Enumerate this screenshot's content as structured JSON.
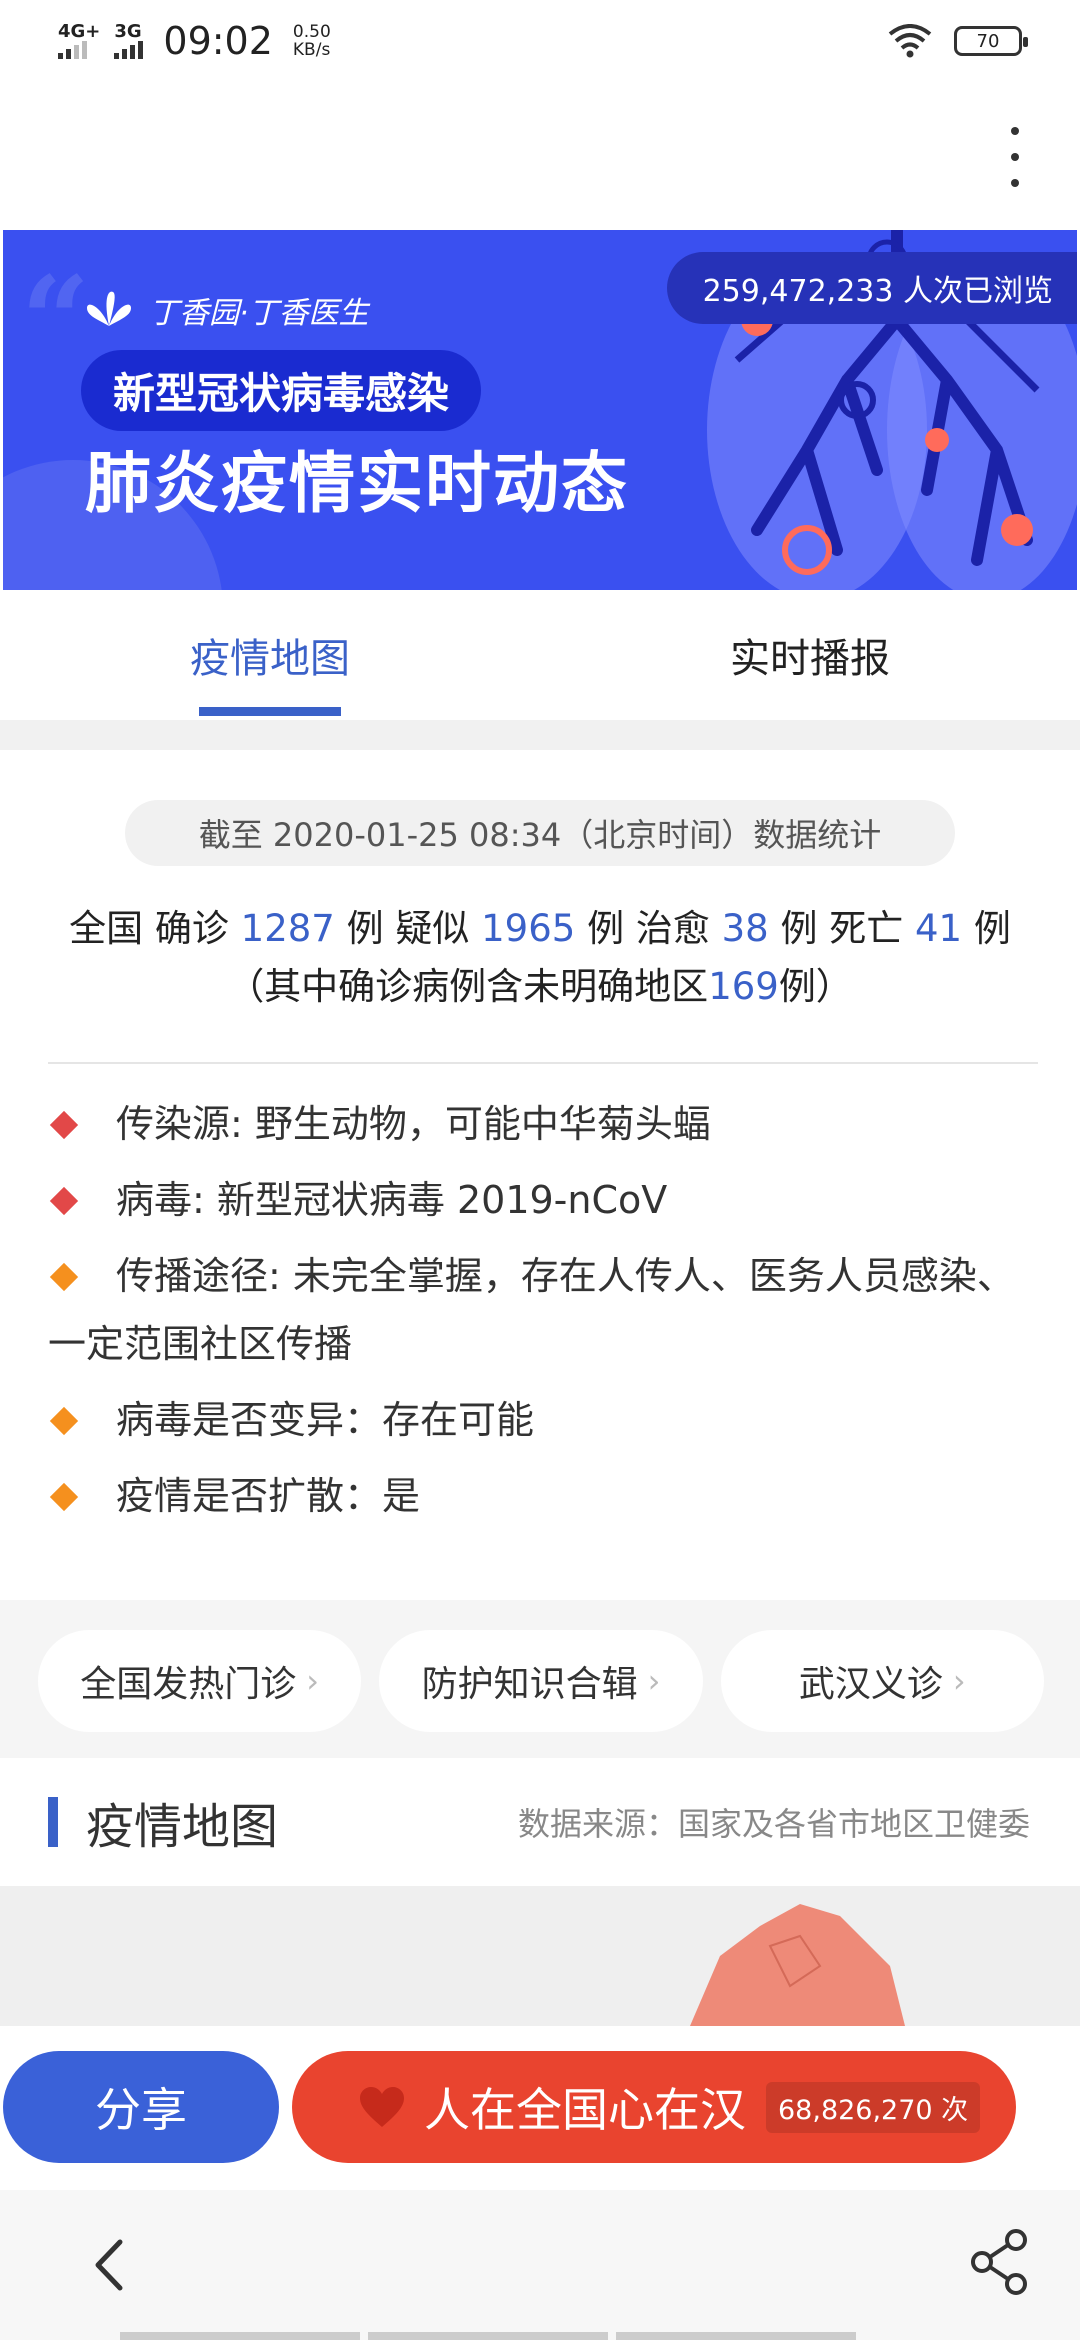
{
  "status_bar": {
    "net1": "4G+",
    "net2": "3G",
    "time": "09:02",
    "speed_value": "0.50",
    "speed_unit": "KB/s",
    "battery": "70"
  },
  "banner": {
    "brand": "丁香园·丁香医生",
    "pill_title": "新型冠状病毒感染",
    "main_title": "肺炎疫情实时动态",
    "views_count": "259,472,233",
    "views_label": "人次已浏览"
  },
  "tabs": [
    {
      "label": "疫情地图",
      "active": true
    },
    {
      "label": "实时播报",
      "active": false
    }
  ],
  "stats": {
    "as_of": "截至 2020-01-25 08:34（北京时间）数据统计",
    "prefix": "全国",
    "confirmed_label": "确诊",
    "confirmed": "1287",
    "suspected_label": "疑似",
    "suspected": "1965",
    "cured_label": "治愈",
    "cured": "38",
    "deaths_label": "死亡",
    "deaths": "41",
    "unit": "例",
    "note_prefix": "（其中确诊病例含未明确地区",
    "unspecified": "169",
    "note_suffix": "例）"
  },
  "facts": [
    {
      "text": "传染源: 野生动物，可能中华菊头蝠",
      "color": "#e24848"
    },
    {
      "text": "病毒: 新型冠状病毒 2019-nCoV",
      "color": "#e24848"
    },
    {
      "text": "传播途径: 未完全掌握，存在人传人、医务人员感染、一定范围社区传播",
      "color": "#f5901e"
    },
    {
      "text": "病毒是否变异：存在可能",
      "color": "#f5901e"
    },
    {
      "text": "疫情是否扩散：是",
      "color": "#f5901e"
    }
  ],
  "quick_links": [
    {
      "label": "全国发热门诊"
    },
    {
      "label": "防护知识合辑"
    },
    {
      "label": "武汉义诊"
    }
  ],
  "map_section": {
    "title": "疫情地图",
    "source": "数据来源：国家及各省市地区卫健委"
  },
  "actions": {
    "share": "分享",
    "support": "人在全国心在汉",
    "support_count": "68,826,270 次"
  },
  "colors": {
    "accent": "#3a61c8",
    "banner": "#3a50f0",
    "support": "#e9442f"
  }
}
